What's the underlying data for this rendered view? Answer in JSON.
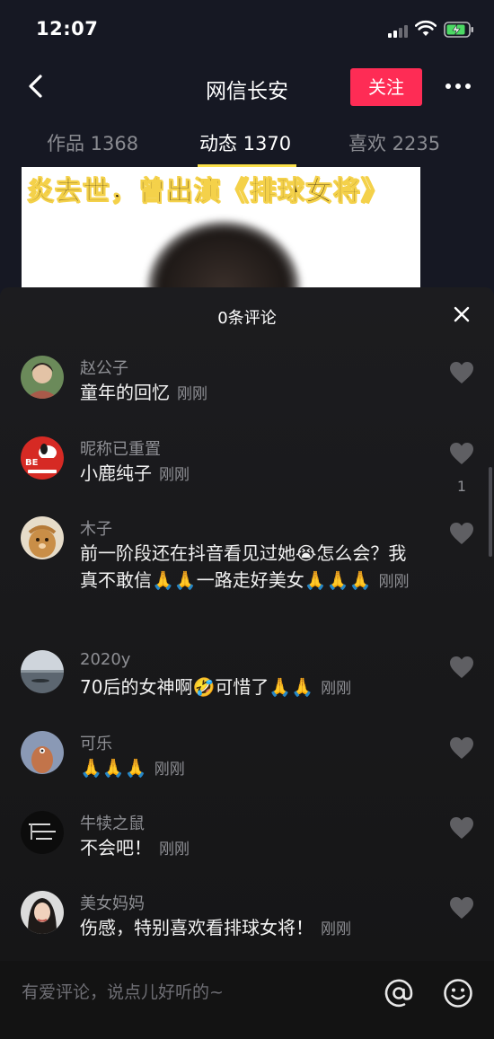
{
  "status_bar": {
    "time": "12:07"
  },
  "header": {
    "title": "网信长安",
    "follow_label": "关注"
  },
  "tabs": [
    {
      "label": "作品 1368",
      "active": false
    },
    {
      "label": "动态 1370",
      "active": true
    },
    {
      "label": "喜欢 2235",
      "active": false
    }
  ],
  "background": {
    "thumbnail_caption": "炎去世，曾出演《排球女将》"
  },
  "comments_panel": {
    "title": "0条评论",
    "comments": [
      {
        "user": "赵公子",
        "text": "童年的回忆",
        "time": "刚刚",
        "likes": ""
      },
      {
        "user": "昵称已重置",
        "text": "小鹿纯子",
        "time": "刚刚",
        "likes": "1"
      },
      {
        "user": "木子",
        "text": "前一阶段还在抖音看见过她😭怎么会？我真不敢信🙏🙏一路走好美女🙏🙏🙏",
        "time": "刚刚",
        "likes": ""
      },
      {
        "user": "2020y",
        "text": "70后的女神啊🤣可惜了🙏🙏",
        "time": "刚刚",
        "likes": ""
      },
      {
        "user": "可乐",
        "text": "🙏🙏🙏",
        "time": "刚刚",
        "likes": ""
      },
      {
        "user": "牛犊之鼠",
        "text": "不会吧！",
        "time": "刚刚",
        "likes": ""
      },
      {
        "user": "美女妈妈",
        "text": "伤感，特别喜欢看排球女将！",
        "time": "刚刚",
        "likes": ""
      }
    ]
  },
  "input": {
    "placeholder": "有爱评论，说点儿好听的~"
  },
  "icons": {
    "back": "chevron-left-icon",
    "more": "more-dots-icon",
    "close": "close-icon",
    "like": "heart-icon",
    "mention": "at-icon",
    "emoji": "smiley-icon"
  },
  "colors": {
    "background": "#161823",
    "follow_button": "#fe2c55",
    "tab_indicator": "#fbe04a",
    "secondary_text": "#8e8f94"
  }
}
